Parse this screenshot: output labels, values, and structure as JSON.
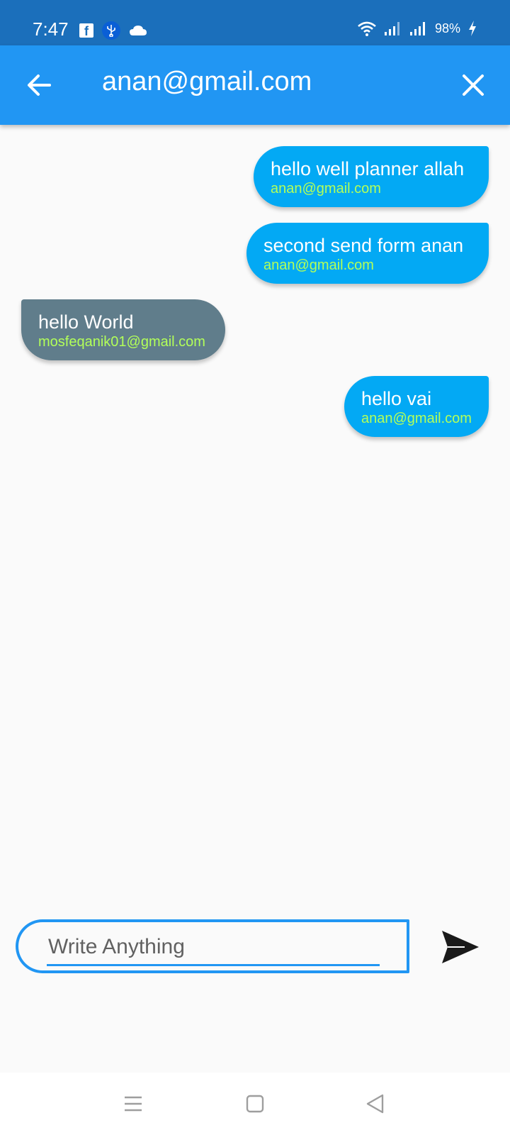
{
  "status_bar": {
    "time": "7:47",
    "battery": "98%",
    "icons_left": [
      "facebook-icon",
      "usb-icon",
      "cloud-icon"
    ],
    "icons_right": [
      "wifi-icon",
      "signal-icon",
      "signal-icon",
      "battery-charging-icon"
    ]
  },
  "app_bar": {
    "title": "anan@gmail.com",
    "background": "#2196f3",
    "back_icon": "arrow-back-icon",
    "close_icon": "close-icon"
  },
  "messages": [
    {
      "text": "hello well planner allah",
      "sender": "anan@gmail.com",
      "direction": "sent"
    },
    {
      "text": "second send form anan",
      "sender": "anan@gmail.com",
      "direction": "sent"
    },
    {
      "text": "hello World",
      "sender": "mosfeqanik01@gmail.com",
      "direction": "received"
    },
    {
      "text": "hello vai",
      "sender": "anan@gmail.com",
      "direction": "sent"
    }
  ],
  "composer": {
    "placeholder": "Write Anything",
    "value": "",
    "send_icon": "send-icon"
  },
  "colors": {
    "status_bar": "#1b6fbb",
    "sent_bubble": "#03a9f4",
    "received_bubble": "#607d8b",
    "sender_text": "#b2ff59"
  },
  "nav_bar": {
    "icons": [
      "menu-icon",
      "home-square-icon",
      "back-triangle-icon"
    ]
  }
}
